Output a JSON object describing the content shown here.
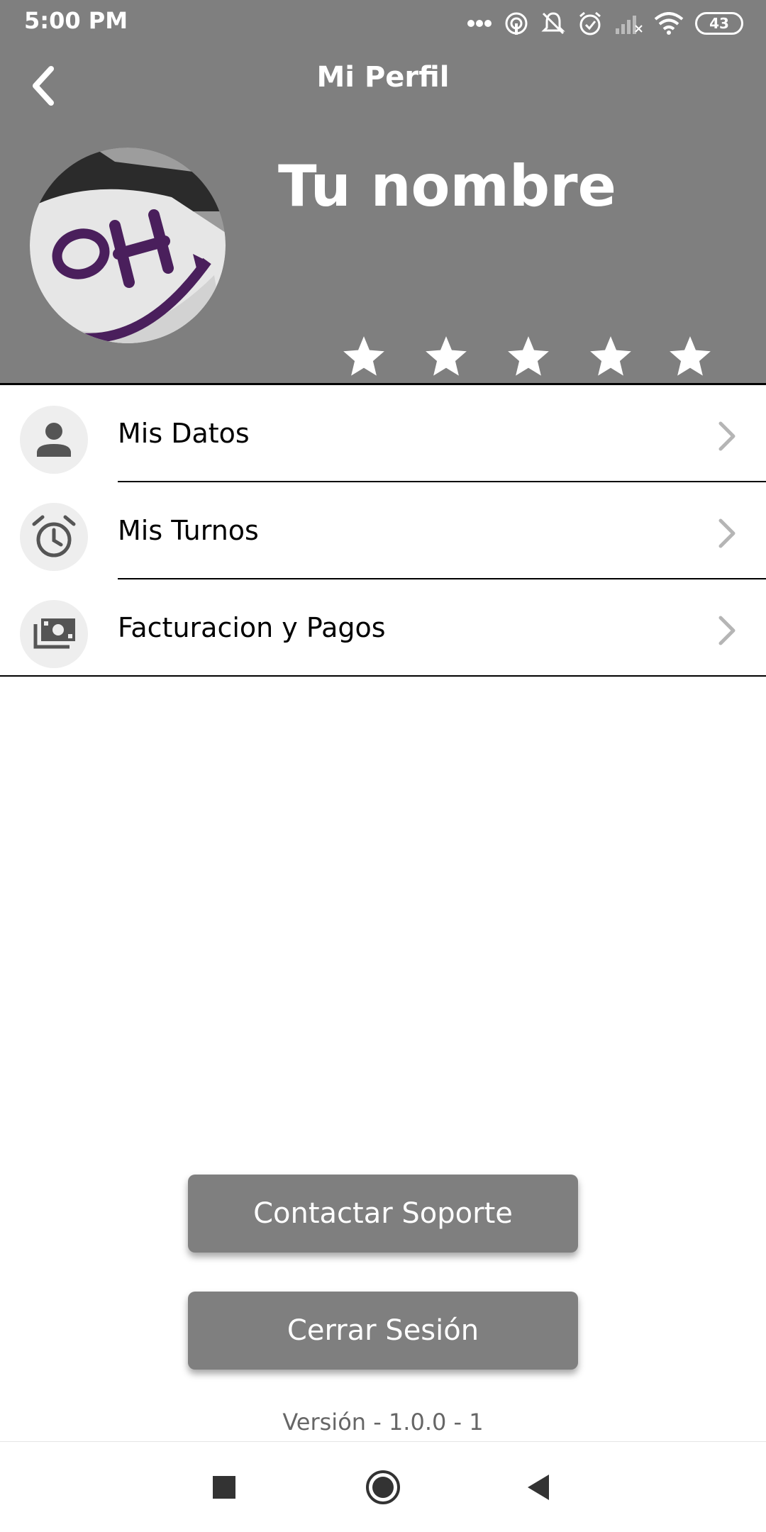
{
  "status_bar": {
    "time": "5:00 PM",
    "battery": "43",
    "icons": [
      "more-dots-icon",
      "hotspot-icon",
      "notifications-off-icon",
      "alarm-icon",
      "signal-icon",
      "wifi-icon",
      "battery-icon"
    ]
  },
  "header": {
    "title": "Mi Perfil",
    "back_icon": "chevron-left-icon",
    "name": "Tu nombre",
    "rating": 5,
    "rating_max": 5
  },
  "menu": {
    "items": [
      {
        "label": "Mis Datos",
        "icon": "person-icon"
      },
      {
        "label": "Mis Turnos",
        "icon": "alarm-clock-icon"
      },
      {
        "label": "Facturacion y Pagos",
        "icon": "money-icon"
      }
    ]
  },
  "buttons": {
    "support": "Contactar Soporte",
    "logout": "Cerrar Sesión"
  },
  "version": "Versión - 1.0.0 - 1",
  "colors": {
    "header_bg": "#7f7f7f",
    "button_bg": "#7f7f7f",
    "icon_circle_bg": "#eeeeee",
    "avatar_purple": "#4a1f5c"
  }
}
